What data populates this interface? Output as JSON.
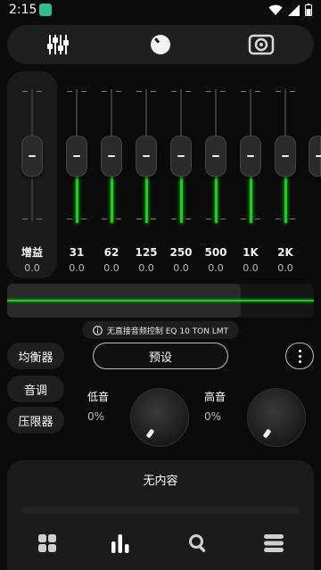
{
  "status_bar": {
    "time": "2:15",
    "icons": [
      "app-badge-icon",
      "wifi-icon",
      "signal-icon",
      "battery-icon"
    ]
  },
  "tabs": [
    {
      "name": "equalizer-tab",
      "icon": "equalizer-icon",
      "active": true
    },
    {
      "name": "bass-tab",
      "icon": "knob-icon"
    },
    {
      "name": "speaker-tab",
      "icon": "speaker-icon"
    }
  ],
  "gain": {
    "label": "增益",
    "value": "0.0"
  },
  "bands": [
    {
      "label": "31",
      "value": "0.0"
    },
    {
      "label": "62",
      "value": "0.0"
    },
    {
      "label": "125",
      "value": "0.0"
    },
    {
      "label": "250",
      "value": "0.0"
    },
    {
      "label": "500",
      "value": "0.0"
    },
    {
      "label": "1K",
      "value": "0.0"
    },
    {
      "label": "2K",
      "value": "0.0"
    }
  ],
  "notice": {
    "text": "无直接音频控制 EQ 10 TON LMT"
  },
  "side_buttons": {
    "equalizer": "均衡器",
    "tone": "音调",
    "limiter": "压限器"
  },
  "preset": {
    "label": "预设"
  },
  "bass": {
    "label": "低音",
    "value": "0%"
  },
  "treble": {
    "label": "高音",
    "value": "0%"
  },
  "now_playing": {
    "title": "无内容"
  },
  "bottom_nav": [
    "grid-icon",
    "bars-icon",
    "search-icon",
    "menu-icon"
  ],
  "colors": {
    "accent": "#18d11a",
    "background": "#0b0b0b",
    "panel": "#1f1f1f"
  }
}
